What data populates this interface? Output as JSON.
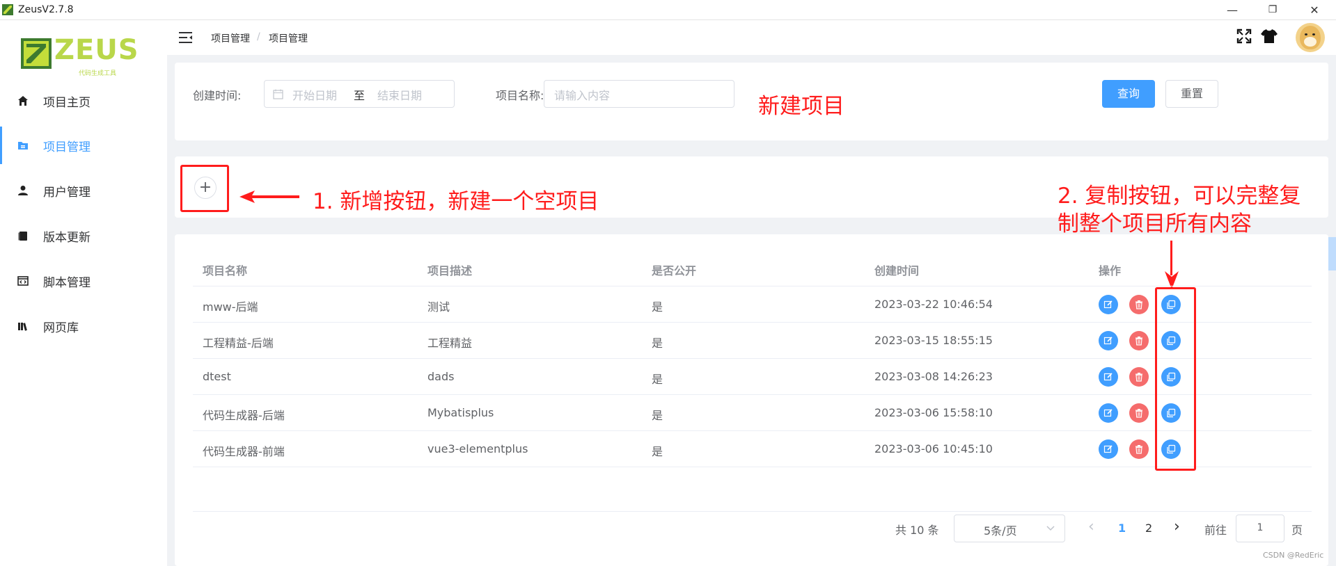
{
  "window": {
    "title": "ZeusV2.7.8",
    "minimize": "—",
    "maximize": "❐",
    "close": "✕"
  },
  "logo": {
    "word": "ZEUS",
    "tagline": "代码生成工具"
  },
  "sidebar": {
    "items": [
      {
        "label": "项目主页",
        "icon": "home-icon"
      },
      {
        "label": "项目管理",
        "icon": "folder-icon",
        "active": true
      },
      {
        "label": "用户管理",
        "icon": "user-icon"
      },
      {
        "label": "版本更新",
        "icon": "document-icon"
      },
      {
        "label": "脚本管理",
        "icon": "code-window-icon"
      },
      {
        "label": "网页库",
        "icon": "books-icon"
      }
    ]
  },
  "header": {
    "breadcrumb": [
      "项目管理",
      "项目管理"
    ],
    "separator": "/"
  },
  "search": {
    "date_label": "创建时间:",
    "start_placeholder": "开始日期",
    "range_separator": "至",
    "end_placeholder": "结束日期",
    "name_label": "项目名称:",
    "name_placeholder": "请输入内容",
    "query_button": "查询",
    "reset_button": "重置"
  },
  "annotations": {
    "new_project": "新建项目",
    "add_note": "1. 新增按钮，新建一个空项目",
    "copy_note_line1": "2. 复制按钮，可以完整复",
    "copy_note_line2": "制整个项目所有内容"
  },
  "add_button": {
    "symbol": "+"
  },
  "table": {
    "headers": [
      "项目名称",
      "项目描述",
      "是否公开",
      "创建时间",
      "操作"
    ],
    "rows": [
      {
        "name": "mww-后端",
        "desc": "测试",
        "public": "是",
        "created": "2023-03-22 10:46:54"
      },
      {
        "name": "工程精益-后端",
        "desc": "工程精益",
        "public": "是",
        "created": "2023-03-15 18:55:15"
      },
      {
        "name": "dtest",
        "desc": "dads",
        "public": "是",
        "created": "2023-03-08 14:26:23"
      },
      {
        "name": "代码生成器-后端",
        "desc": "Mybatisplus",
        "public": "是",
        "created": "2023-03-06 15:58:10"
      },
      {
        "name": "代码生成器-前端",
        "desc": "vue3-elementplus",
        "public": "是",
        "created": "2023-03-06 10:45:10"
      }
    ]
  },
  "pagination": {
    "total": "共 10 条",
    "page_size": "5条/页",
    "prev": "‹",
    "pages": [
      "1",
      "2"
    ],
    "current_page": "1",
    "next": "›",
    "goto_label": "前往",
    "goto_value": "1",
    "page_suffix": "页"
  },
  "watermark": "CSDN @RedEric",
  "colors": {
    "primary": "#409eff",
    "danger": "#f56c6c",
    "annotation": "#ff1c1c"
  }
}
